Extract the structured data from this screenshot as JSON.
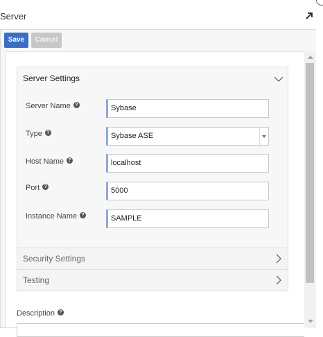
{
  "panel": {
    "title": "Server"
  },
  "toolbar": {
    "save_label": "Save",
    "cancel_label": "Cancel"
  },
  "sections": {
    "server_settings": {
      "title": "Server Settings",
      "expanded": true
    },
    "security_settings": {
      "title": "Security Settings",
      "expanded": false
    },
    "testing": {
      "title": "Testing",
      "expanded": false
    }
  },
  "fields": {
    "server_name": {
      "label": "Server Name",
      "value": "Sybase"
    },
    "type": {
      "label": "Type",
      "value": "Sybase ASE"
    },
    "host_name": {
      "label": "Host Name",
      "value": "localhost"
    },
    "port": {
      "label": "Port",
      "value": "5000"
    },
    "instance_name": {
      "label": "Instance Name",
      "value": "SAMPLE"
    }
  },
  "description": {
    "label": "Description",
    "value": ""
  },
  "icons": {
    "help": "question-mark-icon",
    "expand": "expand-arrow-icon",
    "chevron_down": "chevron-down-icon",
    "chevron_right": "chevron-right-icon"
  },
  "colors": {
    "accent": "#3b6fc6",
    "field_focus_border": "#8fa9d8",
    "disabled_button": "#c7c7c7"
  }
}
